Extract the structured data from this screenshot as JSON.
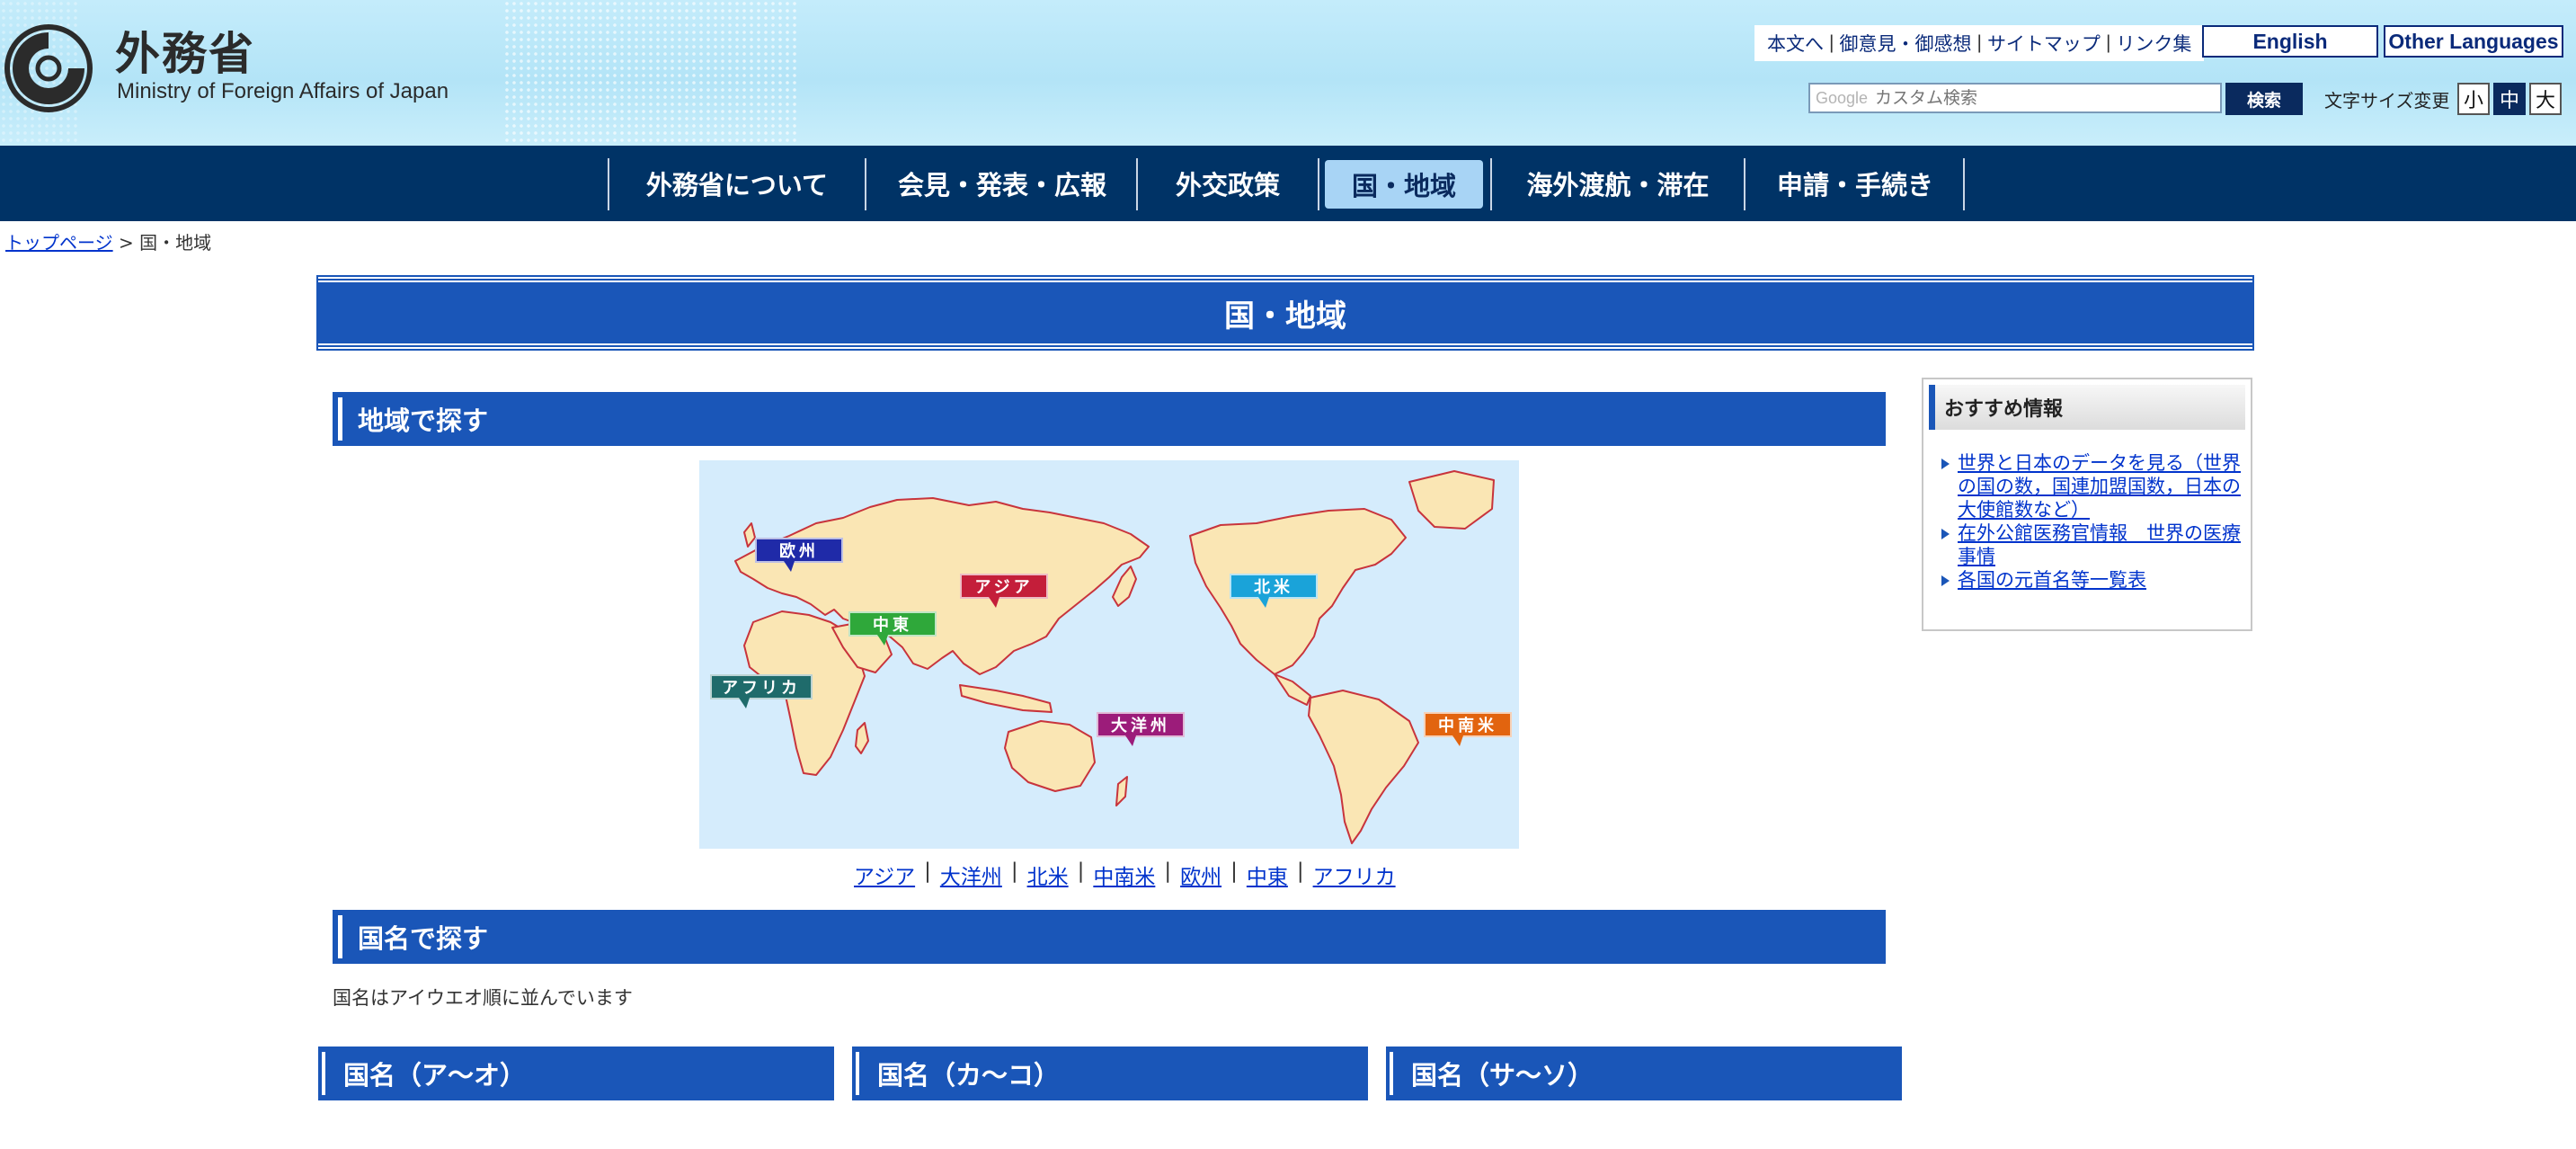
{
  "header": {
    "logo_jp": "外務省",
    "logo_en": "Ministry of Foreign Affairs of Japan",
    "util_links": [
      "本文へ",
      "御意見・御感想",
      "サイトマップ",
      "リンク集"
    ],
    "english_label": "English",
    "other_languages_label": "Other Languages",
    "search_placeholder": "カスタム検索",
    "search_logo_text": "Google",
    "search_button": "検索",
    "font_size_label": "文字サイズ変更",
    "font_sizes": [
      "小",
      "中",
      "大"
    ],
    "font_size_active": "中"
  },
  "nav": {
    "items": [
      "外務省について",
      "会見・発表・広報",
      "外交政策",
      "国・地域",
      "海外渡航・滞在",
      "申請・手続き"
    ],
    "active": "国・地域"
  },
  "breadcrumb": {
    "home": "トップページ",
    "separator": ">",
    "current": "国・地域"
  },
  "page_title": "国・地域",
  "region_section": {
    "heading": "地域で探す",
    "map_labels": [
      {
        "text": "欧州",
        "color": "#1f2aa8"
      },
      {
        "text": "中東",
        "color": "#2fa83a"
      },
      {
        "text": "アジア",
        "color": "#c41e3a"
      },
      {
        "text": "アフリカ",
        "color": "#1f6b6b"
      },
      {
        "text": "大洋州",
        "color": "#9c1c7a"
      },
      {
        "text": "北米",
        "color": "#1aa3d9"
      },
      {
        "text": "中南米",
        "color": "#e2640f"
      }
    ],
    "links": [
      "アジア",
      "大洋州",
      "北米",
      "中南米",
      "欧州",
      "中東",
      "アフリカ"
    ]
  },
  "country_section": {
    "heading": "国名で探す",
    "note": "国名はアイウエオ順に並んでいます",
    "columns": [
      "国名（ア〜オ）",
      "国名（カ〜コ）",
      "国名（サ〜ソ）"
    ]
  },
  "recommended": {
    "heading": "おすすめ情報",
    "items": [
      "世界と日本のデータを見る（世界の国の数，国連加盟国数，日本の大使館数など）",
      "在外公館医務官情報　世界の医療事情",
      "各国の元首名等一覧表"
    ]
  },
  "colors": {
    "nav_bg": "#003366",
    "section_blue": "#1a56b8",
    "active_nav_bg": "#a8d4f5",
    "link": "#0033cc"
  }
}
